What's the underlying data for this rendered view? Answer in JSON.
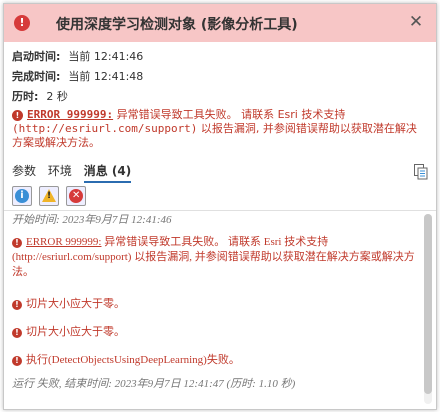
{
  "dialog": {
    "title": "使用深度学习检测对象 (影像分析工具)"
  },
  "meta": {
    "start_label": "启动时间:",
    "start_value": "当前 12:41:46",
    "end_label": "完成时间:",
    "end_value": "当前 12:41:48",
    "duration_label": "历时:",
    "duration_value": "2 秒"
  },
  "error_summary": {
    "code": "ERROR 999999:",
    "line1": " 异常错误导致工具失败。 请联系 Esri 技术支持",
    "url": "(http://esriurl.com/support)",
    "line2": " 以报告漏洞, 并参阅错误帮助以获取潜在解决方案或解决方法。"
  },
  "tabs": [
    {
      "label": "参数"
    },
    {
      "label": "环境"
    },
    {
      "label": "消息 (4)"
    }
  ],
  "filters": {
    "info": "i",
    "warn": "!",
    "error": "✕"
  },
  "messages": {
    "start": "开始时间: 2023年9月7日 12:41:46",
    "err1_code": "ERROR 999999:",
    "err1_text": " 异常错误导致工具失败。 请联系 Esri 技术支持 (http://esriurl.com/support) 以报告漏洞, 并参阅错误帮助以获取潜在解决方案或解决方法。",
    "err2": "切片大小应大于零。",
    "err3": "切片大小应大于零。",
    "err4": "执行(DetectObjectsUsingDeepLearning)失败。",
    "end": "运行 失败, 结束时间: 2023年9月7日 12:41:47 (历时: 1.10 秒)"
  },
  "icons": {
    "title": "error-icon",
    "close": "close-icon",
    "copy": "copy-icon"
  }
}
